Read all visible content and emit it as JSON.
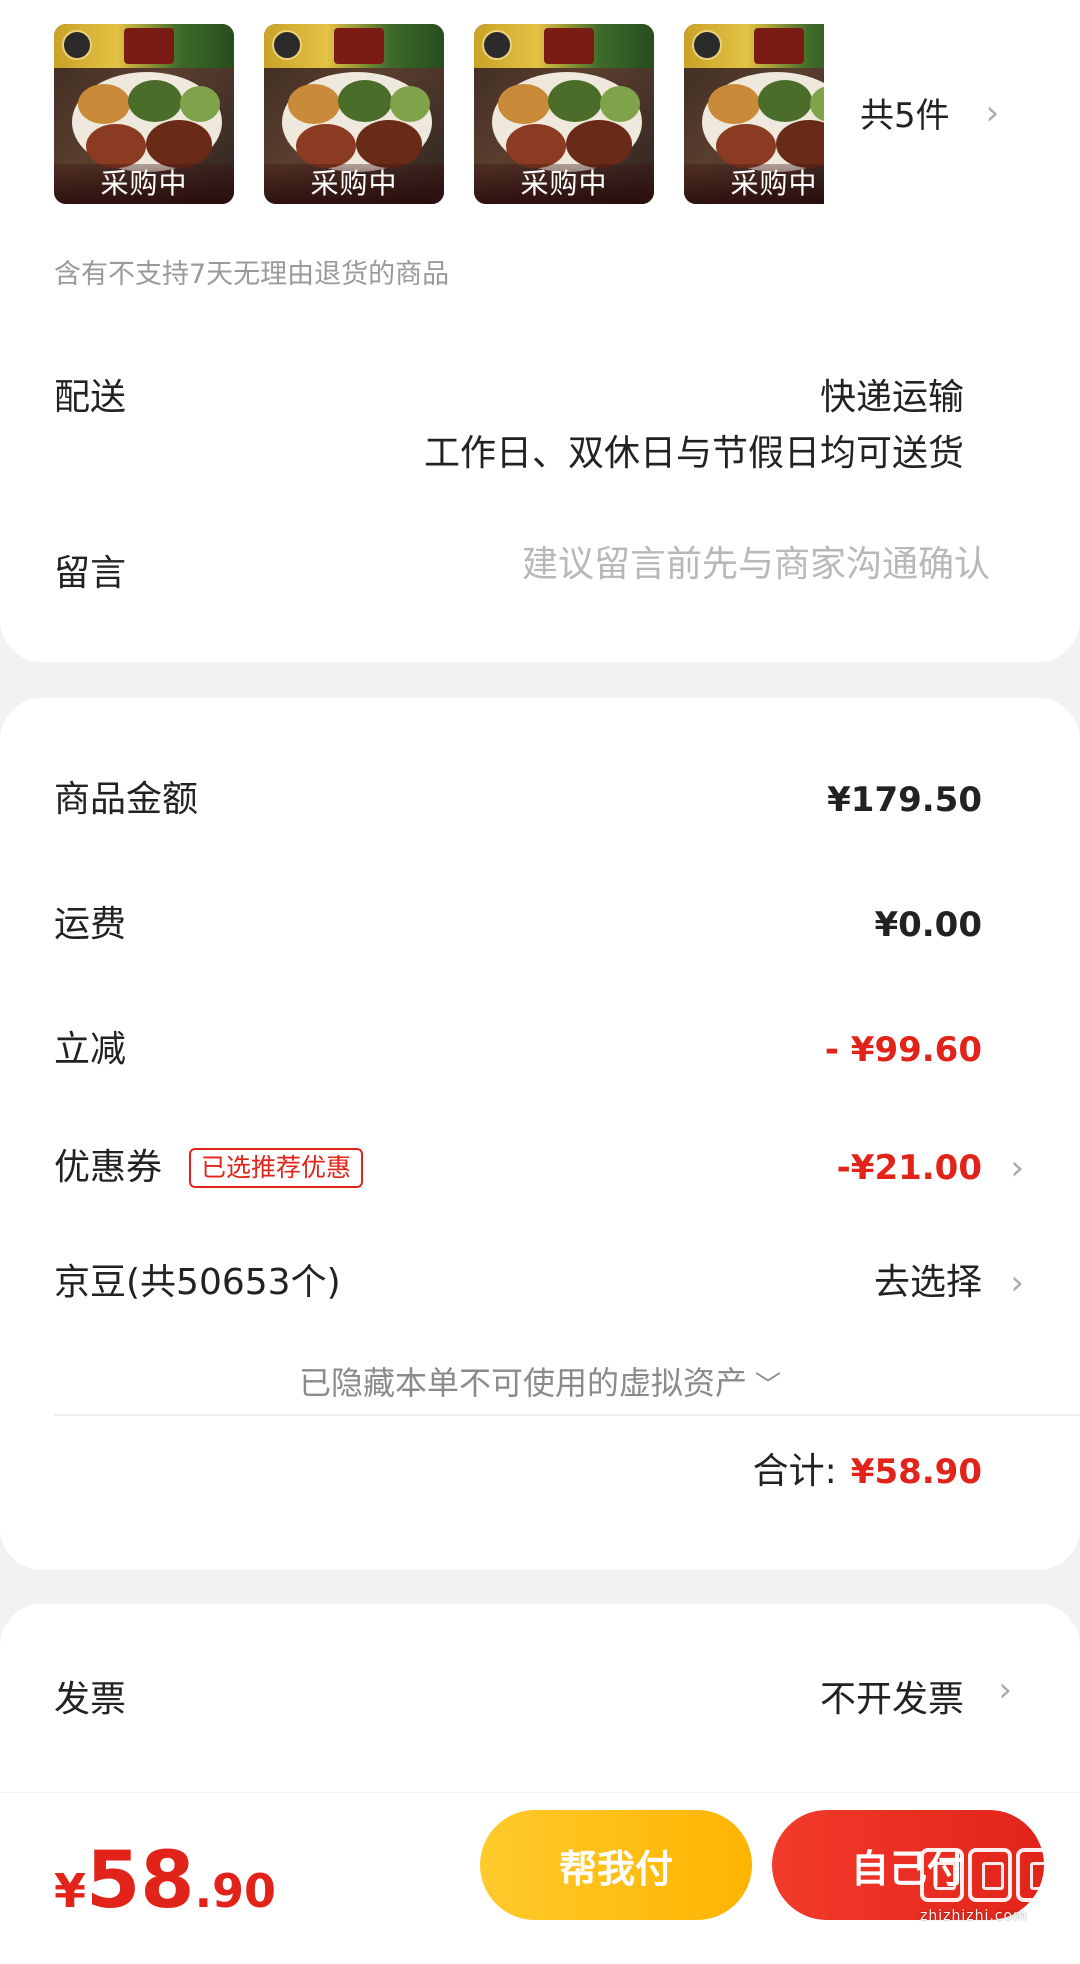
{
  "products": {
    "thumbnails": [
      {
        "icon": "snack-platter-image",
        "status": "采购中"
      },
      {
        "icon": "snack-platter-image",
        "status": "采购中"
      },
      {
        "icon": "snack-platter-image",
        "status": "采购中"
      },
      {
        "icon": "snack-platter-image",
        "status": "采购中"
      }
    ],
    "count_label": "共5件",
    "return_note": "含有不支持7天无理由退货的商品"
  },
  "delivery": {
    "label": "配送",
    "method": "快递运输",
    "time": "工作日、双休日与节假日均可送货"
  },
  "message": {
    "label": "留言",
    "value": "",
    "placeholder": "建议留言前先与商家沟通确认"
  },
  "price": {
    "goods_label": "商品金额",
    "goods_value": "¥179.50",
    "shipping_label": "运费",
    "shipping_value": "¥0.00",
    "discount_label": "立减",
    "discount_value": "- ¥99.60",
    "coupon_label": "优惠券",
    "coupon_tag": "已选推荐优惠",
    "coupon_value": "-¥21.00",
    "beans_label": "京豆(共50653个)",
    "beans_action": "去选择",
    "hidden_assets": "已隐藏本单不可使用的虚拟资产",
    "total_label": "合计:",
    "total_value": "¥58.90"
  },
  "invoice": {
    "label": "发票",
    "value": "不开发票"
  },
  "bottom_bar": {
    "currency": "¥",
    "amount_int": "58",
    "amount_dec": ".90",
    "help_pay_label": "帮我付",
    "self_pay_label": "自己付"
  },
  "watermark": {
    "text": "zhizhizhi.com"
  },
  "colors": {
    "accent_red": "#e2231a",
    "help_button": "#ffb400",
    "background": "#f2f2f2"
  }
}
